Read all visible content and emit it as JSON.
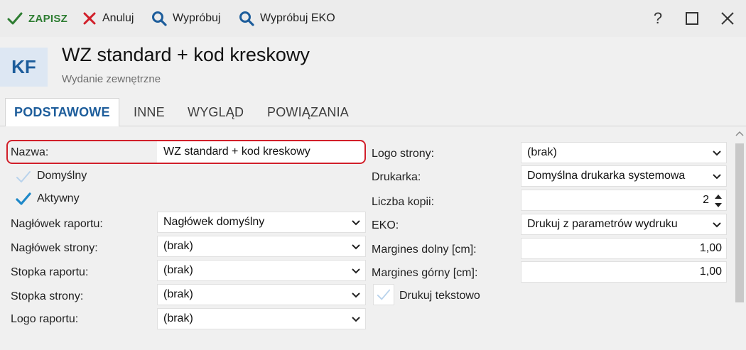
{
  "toolbar": {
    "save": "ZAPISZ",
    "cancel": "Anuluj",
    "try": "Wypróbuj",
    "try_eko": "Wypróbuj EKO",
    "help": "?"
  },
  "header": {
    "badge": "KF",
    "title": "WZ standard + kod kreskowy",
    "subtitle": "Wydanie zewnętrzne"
  },
  "tabs": [
    {
      "label": "PODSTAWOWE",
      "active": true
    },
    {
      "label": "INNE",
      "active": false
    },
    {
      "label": "WYGLĄD",
      "active": false
    },
    {
      "label": "POWIĄZANIA",
      "active": false
    }
  ],
  "left": {
    "name_label": "Nazwa:",
    "name_value": "WZ standard + kod kreskowy",
    "default_label": "Domyślny",
    "default_checked": false,
    "active_label": "Aktywny",
    "active_checked": true,
    "report_header_label": "Nagłówek raportu:",
    "report_header_value": "Nagłówek domyślny",
    "page_header_label": "Nagłówek strony:",
    "page_header_value": "(brak)",
    "report_footer_label": "Stopka raportu:",
    "report_footer_value": "(brak)",
    "page_footer_label": "Stopka strony:",
    "page_footer_value": "(brak)",
    "report_logo_label": "Logo raportu:",
    "report_logo_value": "(brak)"
  },
  "right": {
    "page_logo_label": "Logo strony:",
    "page_logo_value": "(brak)",
    "printer_label": "Drukarka:",
    "printer_value": "Domyślna drukarka systemowa",
    "copies_label": "Liczba kopii:",
    "copies_value": "2",
    "eko_label": "EKO:",
    "eko_value": "Drukuj z parametrów wydruku",
    "margin_bottom_label": "Margines dolny [cm]:",
    "margin_bottom_value": "1,00",
    "margin_top_label": "Margines górny [cm]:",
    "margin_top_value": "1,00",
    "text_print_label": "Drukuj tekstowo",
    "text_print_checked": false
  },
  "colors": {
    "accent": "#1d5d9b",
    "save_green": "#2e7d32",
    "cancel_red": "#d11f2a",
    "check_blue": "#1e88c8",
    "highlight": "#d11f2a"
  },
  "icons": {
    "save": "check-icon",
    "cancel": "x-icon",
    "try": "search-icon",
    "try_eko": "search-icon",
    "help": "help-icon",
    "maximize": "maximize-icon",
    "close": "close-icon"
  }
}
